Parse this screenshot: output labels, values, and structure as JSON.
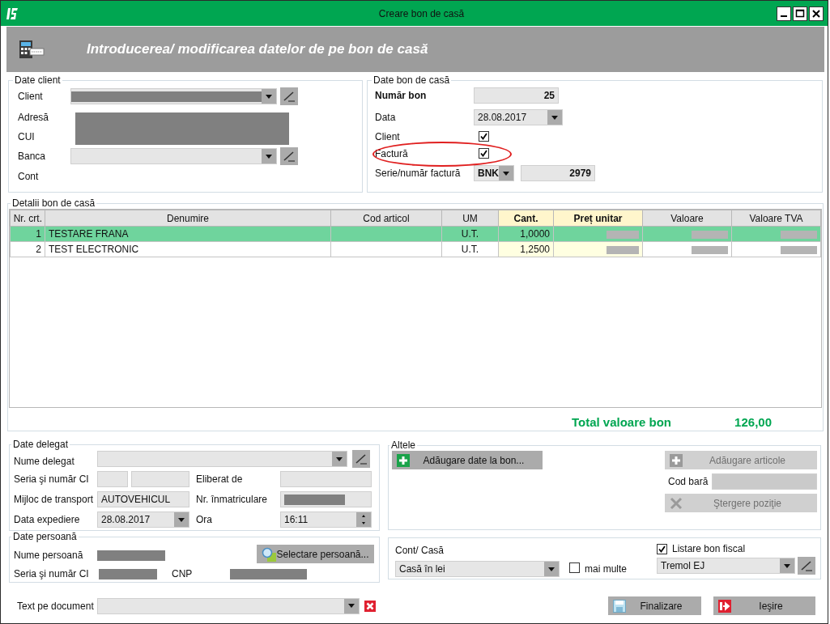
{
  "window": {
    "title": "Creare bon de casă"
  },
  "header": {
    "title": "Introducerea/ modificarea datelor de pe bon de casă"
  },
  "client_group": {
    "title": "Date client",
    "redacted": true,
    "client_label": "Client",
    "client_redacted": true,
    "address_label": "Adresă",
    "cui_label": "CUI",
    "bank_label": "Banca",
    "account_label": "Cont"
  },
  "receipt_group": {
    "title": "Date bon de casă",
    "number_label": "Număr bon",
    "number": "25",
    "date_label": "Data",
    "date": "28.08.2017",
    "client_label": "Client",
    "client_checked": true,
    "invoice_label": "Factură",
    "invoice_checked": true,
    "invoice_circled": true,
    "series_label": "Serie/număr factură",
    "series": "BNK",
    "invoice_number": "2979"
  },
  "details": {
    "title": "Detalii bon de casă",
    "columns": [
      {
        "label": "Nr. crt.",
        "highlighted": false
      },
      {
        "label": "Denumire",
        "highlighted": false
      },
      {
        "label": "Cod articol",
        "highlighted": false
      },
      {
        "label": "UM",
        "highlighted": false
      },
      {
        "label": "Cant.",
        "highlighted": true
      },
      {
        "label": "Preț unitar",
        "highlighted": true
      },
      {
        "label": "Valoare",
        "highlighted": false
      },
      {
        "label": "Valoare TVA",
        "highlighted": false
      }
    ],
    "rows": [
      {
        "selected": true,
        "number": "1",
        "name": "TESTARE FRANA",
        "unit": "U.T.",
        "quantity": "1,0000",
        "amounts_redacted": true
      },
      {
        "selected": false,
        "number": "2",
        "name": "TEST ELECTRONIC",
        "unit": "U.T.",
        "quantity": "1,2500",
        "amounts_redacted": true
      }
    ],
    "total_label": "Total valoare bon",
    "total": "126,00"
  },
  "delegate": {
    "title": "Date delegat",
    "name_label": "Nume delegat",
    "ci_label": "Seria şi număr CI",
    "issued_label": "Eliberat de",
    "transport_label": "Mijloc de transport",
    "transport": "AUTOVEHICUL",
    "plate_label": "Nr. înmatriculare",
    "plate_redacted": true,
    "ship_date_label": "Data expediere",
    "ship_date": "28.08.2017",
    "time_label": "Ora",
    "time": "16:11"
  },
  "person": {
    "title": "Date persoană",
    "name_label": "Nume persoană",
    "ci_label": "Seria şi număr CI",
    "cnp_label": "CNP",
    "redacted": true,
    "select_button": "Selectare persoană..."
  },
  "document_text": {
    "label": "Text pe document"
  },
  "other": {
    "title": "Altele",
    "add_data_button": {
      "label": "Adăugare date la bon...",
      "disabled": false
    },
    "add_items_button": {
      "label": "Adăugare articole",
      "disabled": true
    },
    "barcode_label": "Cod bară",
    "delete_button": {
      "label": "Ştergere poziţie",
      "disabled": true
    }
  },
  "cash": {
    "title": "Cont/ Casă",
    "account": "Casă în lei",
    "more_label": "mai multe",
    "more_checked": false,
    "print_label": "Listare bon fiscal",
    "print_checked": true,
    "printer": "Tremol EJ"
  },
  "buttons": [
    {
      "label": "Finalizare",
      "kind": "save"
    },
    {
      "label": "Ieşire",
      "kind": "exit"
    }
  ]
}
